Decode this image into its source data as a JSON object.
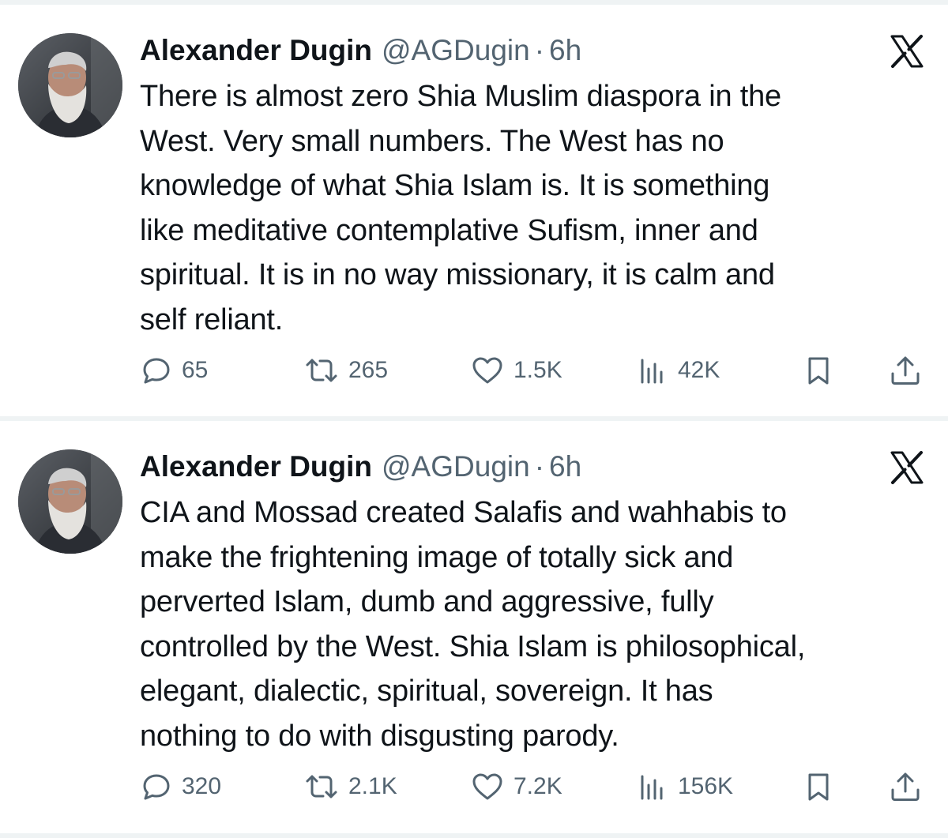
{
  "tweets": [
    {
      "display_name": "Alexander Dugin",
      "handle": "@AGDugin",
      "separator": "·",
      "time": "6h",
      "platform_icon": "x-logo-icon",
      "text": "There is almost zero Shia Muslim diaspora in the\nWest. Very small numbers. The West has no\nknowledge of what Shia Islam is. It is something\nlike meditative contemplative Sufism, inner and\nspiritual. It is in no way missionary, it is calm and\nself reliant.",
      "replies": "65",
      "reposts": "265",
      "likes": "1.5K",
      "views": "42K"
    },
    {
      "display_name": "Alexander Dugin",
      "handle": "@AGDugin",
      "separator": "·",
      "time": "6h",
      "platform_icon": "x-logo-icon",
      "text": "CIA and Mossad created Salafis and wahhabis to\nmake the frightening image of totally sick and\nperverted Islam, dumb and aggressive, fully\ncontrolled by the West. Shia Islam is philosophical,\nelegant, dialectic,  spiritual, sovereign. It has\nnothing to do with disgusting parody.",
      "replies": "320",
      "reposts": "2.1K",
      "likes": "7.2K",
      "views": "156K"
    }
  ],
  "colors": {
    "text_primary": "#0f1419",
    "text_secondary": "#536471",
    "divider": "#eff3f4",
    "background": "#ffffff"
  },
  "icons": [
    "reply-icon",
    "repost-icon",
    "like-icon",
    "views-icon",
    "bookmark-icon",
    "share-icon"
  ]
}
